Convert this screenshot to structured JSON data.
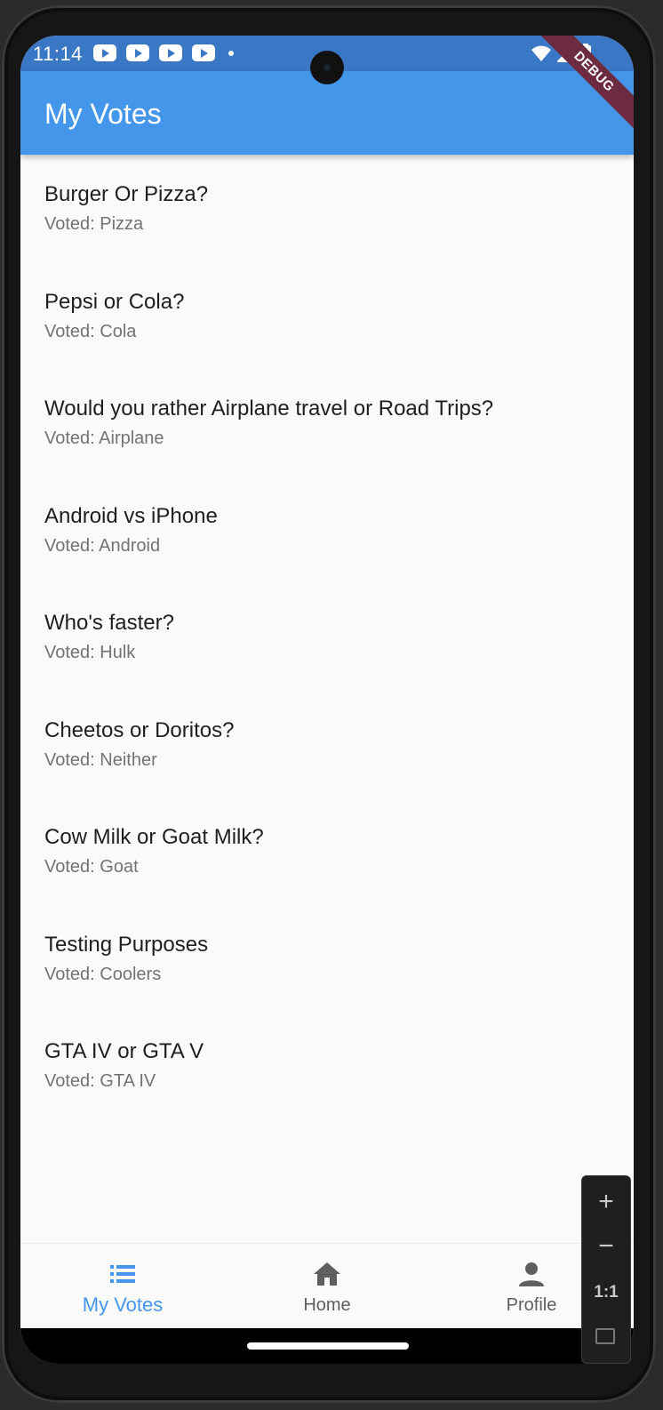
{
  "status_bar": {
    "time": "11:14",
    "debug_label": "DEBUG"
  },
  "app_bar": {
    "title": "My Votes"
  },
  "votes": [
    {
      "question": "Burger Or Pizza?",
      "answer": "Voted: Pizza"
    },
    {
      "question": "Pepsi or Cola?",
      "answer": "Voted: Cola"
    },
    {
      "question": "Would you rather Airplane travel or Road Trips?",
      "answer": "Voted: Airplane"
    },
    {
      "question": "Android vs iPhone",
      "answer": "Voted: Android"
    },
    {
      "question": "Who's faster?",
      "answer": "Voted: Hulk"
    },
    {
      "question": "Cheetos or Doritos?",
      "answer": "Voted: Neither"
    },
    {
      "question": "Cow Milk or Goat Milk?",
      "answer": "Voted: Goat"
    },
    {
      "question": "Testing Purposes",
      "answer": "Voted: Coolers"
    },
    {
      "question": "GTA IV or GTA V",
      "answer": "Voted: GTA IV"
    }
  ],
  "bottom_nav": {
    "items": [
      {
        "label": "My Votes",
        "icon": "list-icon",
        "active": true
      },
      {
        "label": "Home",
        "icon": "home-icon",
        "active": false
      },
      {
        "label": "Profile",
        "icon": "person-icon",
        "active": false
      }
    ]
  },
  "zoom_controls": {
    "zoom_in": "+",
    "zoom_out": "−",
    "reset": "1:1"
  },
  "colors": {
    "app_bar": "#4396ea",
    "status_bar": "#3a78c6",
    "active_nav": "#4396ea",
    "inactive_nav": "#5f5f5f",
    "debug_banner": "#6d2b3f"
  }
}
